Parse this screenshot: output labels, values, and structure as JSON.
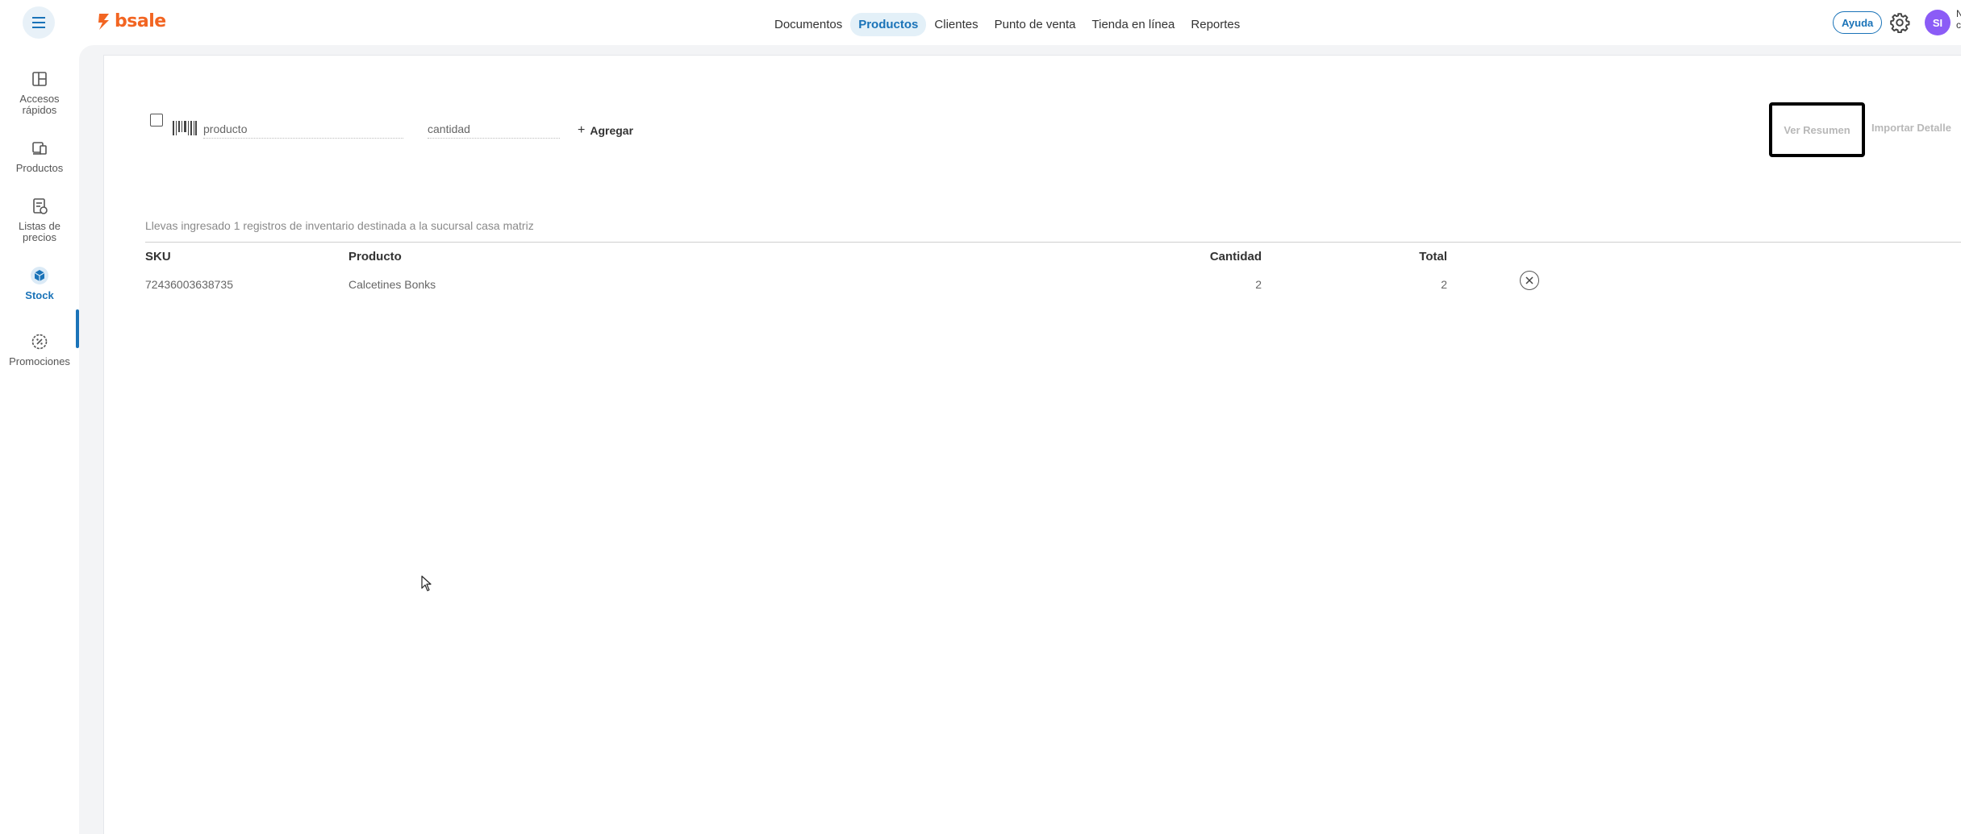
{
  "brand": {
    "name": "bsale",
    "color": "#f26522"
  },
  "topnav": {
    "items": [
      {
        "label": "Documentos",
        "active": false
      },
      {
        "label": "Productos",
        "active": true
      },
      {
        "label": "Clientes",
        "active": false
      },
      {
        "label": "Punto de venta",
        "active": false
      },
      {
        "label": "Tienda en línea",
        "active": false
      },
      {
        "label": "Reportes",
        "active": false
      }
    ],
    "help_label": "Ayuda",
    "avatar_initials": "SI",
    "avatar_overflow_text": "N\nc"
  },
  "sidenav": {
    "items": [
      {
        "label": "Accesos rápidos",
        "icon": "grid-icon",
        "active": false
      },
      {
        "label": "Productos",
        "icon": "products-icon",
        "active": false
      },
      {
        "label": "Listas de precios",
        "icon": "price-list-icon",
        "active": false
      },
      {
        "label": "Stock",
        "icon": "cube-icon",
        "active": true
      },
      {
        "label": "Promociones",
        "icon": "promotions-icon",
        "active": false
      }
    ]
  },
  "entry": {
    "product_placeholder": "producto",
    "quantity_placeholder": "cantidad",
    "add_label": "Agregar"
  },
  "actions": {
    "summary_label": "Ver Resumen",
    "import_label": "Importar Detalle"
  },
  "summary_text": "Llevas ingresado 1 registros de inventario destinada a la sucursal casa matriz",
  "table": {
    "headers": {
      "sku": "SKU",
      "product": "Producto",
      "quantity": "Cantidad",
      "total": "Total"
    },
    "rows": [
      {
        "sku": "72436003638735",
        "product": "Calcetines Bonks",
        "quantity": "2",
        "total": "2"
      }
    ]
  },
  "colors": {
    "accent": "#1a73b8",
    "avatar": "#8b5cf6",
    "muted": "#b8b8b8"
  }
}
